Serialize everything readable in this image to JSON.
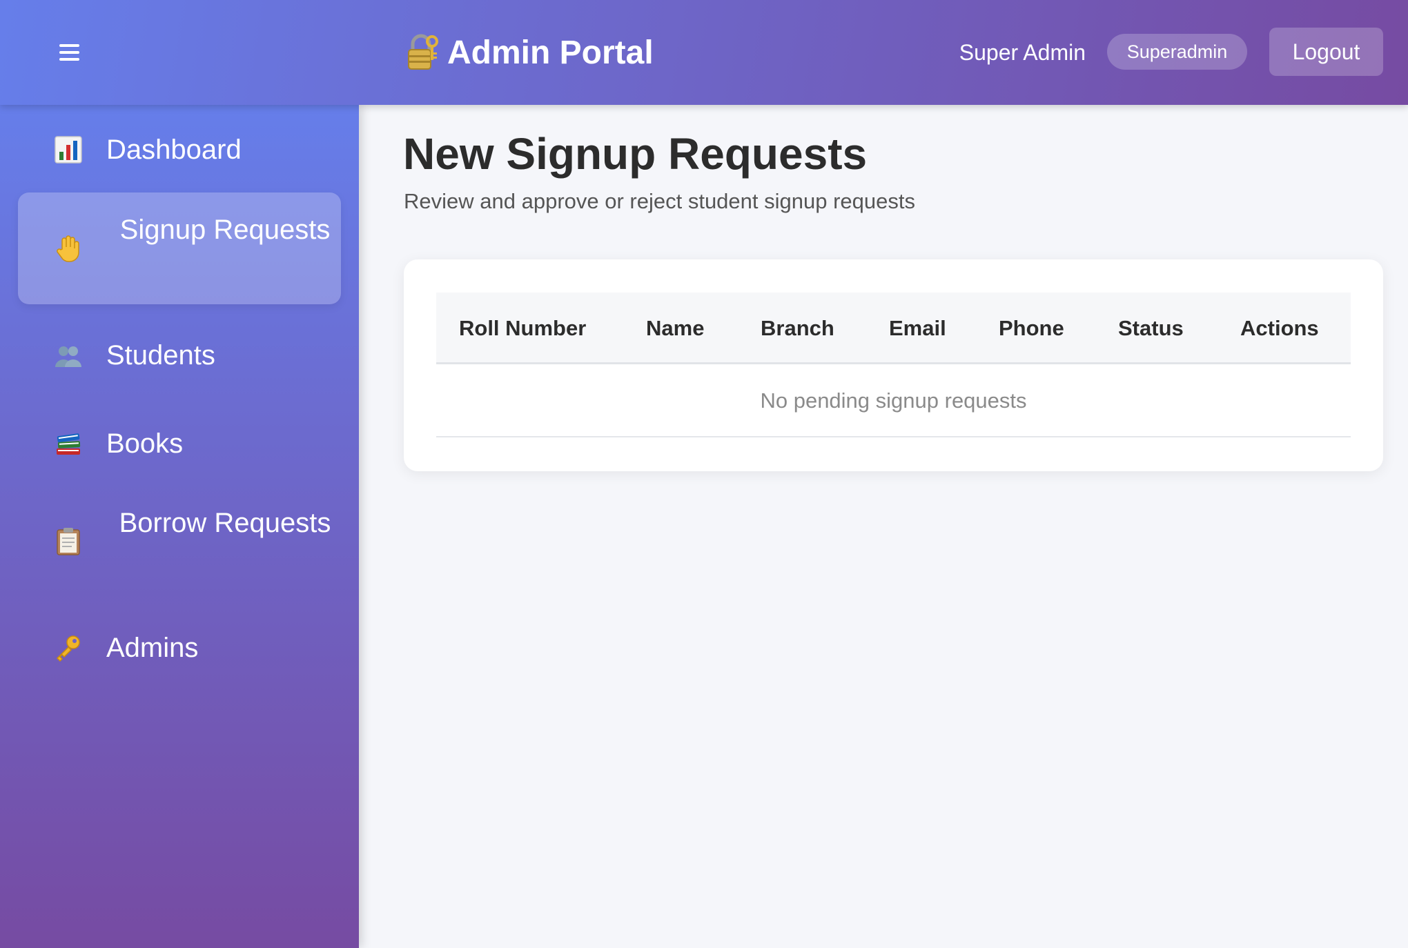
{
  "header": {
    "menu_icon": "hamburger-menu-icon",
    "brand_icon": "lock-with-key-icon",
    "brand_title": "Admin Portal",
    "user_name": "Super Admin",
    "role_badge": "Superadmin",
    "logout_label": "Logout"
  },
  "sidebar": {
    "items": [
      {
        "label": "Dashboard",
        "icon": "bar-chart-icon",
        "active": false
      },
      {
        "label": "Signup Requests",
        "icon": "raised-hand-icon",
        "active": true
      },
      {
        "label": "Students",
        "icon": "people-icon",
        "active": false
      },
      {
        "label": "Books",
        "icon": "books-icon",
        "active": false
      },
      {
        "label": "Borrow Requests",
        "icon": "clipboard-icon",
        "active": false
      },
      {
        "label": "Admins",
        "icon": "key-icon",
        "active": false
      }
    ]
  },
  "main": {
    "title": "New Signup Requests",
    "subtitle": "Review and approve or reject student signup requests",
    "table": {
      "columns": [
        "Roll Number",
        "Name",
        "Branch",
        "Email",
        "Phone",
        "Status",
        "Actions"
      ],
      "rows": [],
      "empty_message": "No pending signup requests"
    }
  },
  "colors": {
    "gradient_start": "#667eea",
    "gradient_end": "#764ba2",
    "page_background": "#f5f6fa",
    "card_background": "#ffffff",
    "heading_text": "#2c2c2c"
  }
}
